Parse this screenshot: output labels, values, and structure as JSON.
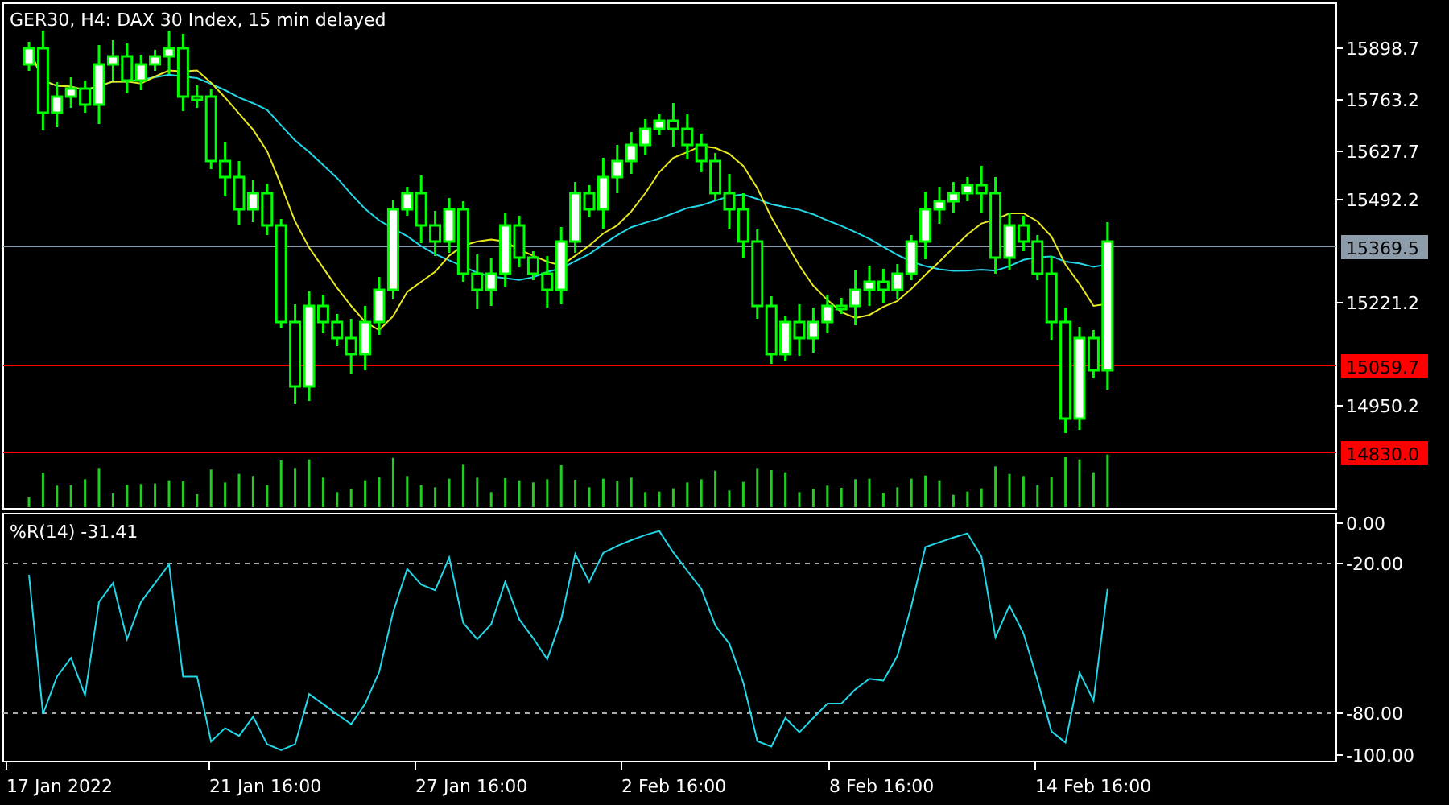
{
  "chart": {
    "title": "GER30, H4:  DAX 30 Index, 15 min delayed",
    "price_ticks": [
      "15898.7",
      "15763.2",
      "15627.7",
      "15492.2",
      "15221.2",
      "14950.2"
    ],
    "lines": [
      {
        "label": "15369.5",
        "kind": "bid"
      },
      {
        "label": "15059.7",
        "kind": "level"
      },
      {
        "label": "14830.0",
        "kind": "level"
      }
    ]
  },
  "indicator": {
    "title": "%R(14) -31.41",
    "ticks": [
      "0.00",
      "-20.00",
      "-80.00",
      "-100.00"
    ]
  },
  "time_axis": [
    "17 Jan 2022",
    "21 Jan 16:00",
    "27 Jan 16:00",
    "2 Feb 16:00",
    "8 Feb 16:00",
    "14 Feb 16:00"
  ]
}
